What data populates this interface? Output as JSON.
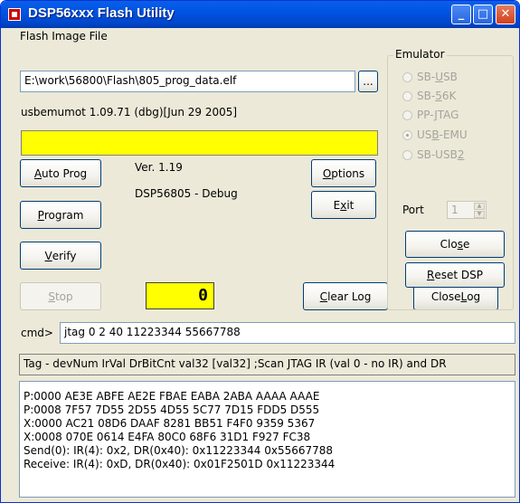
{
  "window": {
    "title": "DSP56xxx Flash Utility",
    "minimize": "_",
    "maximize": "□",
    "close": "✕"
  },
  "flash": {
    "label": "Flash Image File",
    "path": "E:\\work\\56800\\Flash\\805_prog_data.elf",
    "browse": "..."
  },
  "status": {
    "driver": "usbemumot 1.09.71 (dbg)[Jun 29 2005]",
    "version": "Ver. 1.19",
    "target": "DSP56805 - Debug",
    "counter": "0"
  },
  "buttons": {
    "auto_prog": {
      "pre": "",
      "u": "A",
      "post": "uto Prog"
    },
    "program": {
      "pre": "",
      "u": "P",
      "post": "rogram"
    },
    "verify": {
      "pre": "",
      "u": "V",
      "post": "erify"
    },
    "stop": {
      "pre": "",
      "u": "S",
      "post": "top"
    },
    "options": {
      "pre": "",
      "u": "O",
      "post": "ptions"
    },
    "exit": {
      "pre": "E",
      "u": "x",
      "post": "it"
    },
    "clear_log": {
      "pre": "",
      "u": "C",
      "post": "lear Log"
    },
    "close_log": {
      "pre": "Close ",
      "u": "L",
      "post": "og"
    },
    "close": {
      "pre": "Clo",
      "u": "s",
      "post": "e"
    },
    "reset_dsp": {
      "pre": "",
      "u": "R",
      "post": "eset DSP"
    }
  },
  "emulator": {
    "label": "Emulator",
    "options": [
      {
        "pre": "SB-",
        "u": "U",
        "post": "SB",
        "selected": false
      },
      {
        "pre": "SB-",
        "u": "5",
        "post": "6K",
        "selected": false
      },
      {
        "pre": "PP-",
        "u": "J",
        "post": "TAG",
        "selected": false
      },
      {
        "pre": "US",
        "u": "B",
        "post": "-EMU",
        "selected": true
      },
      {
        "pre": "SB-USB",
        "u": "2",
        "post": "",
        "selected": false
      }
    ],
    "port_label": "Port",
    "port_value": "1"
  },
  "cmd": {
    "prompt": "cmd>",
    "value": "jtag 0 2 40 11223344 55667788"
  },
  "info": "Tag - devNum IrVal DrBitCnt val32 [val32] ;Scan JTAG IR (val 0 - no IR) and DR",
  "log": [
    "P:0000 AE3E ABFE AE2E FBAE EABA 2ABA AAAA AAAE",
    "P:0008 7F57 7D55 2D55 4D55 5C77 7D15 FDD5 D555",
    "X:0000 AC21 08D6 DAAF 8281 BB51 F4F0 9359 5367",
    "X:0008 070E 0614 E4FA 80C0 68F6 31D1 F927 FC38",
    "Send(0): IR(4): 0x2, DR(0x40): 0x11223344 0x55667788",
    "Receive: IR(4): 0xD, DR(0x40): 0x01F2501D 0x11223344"
  ]
}
